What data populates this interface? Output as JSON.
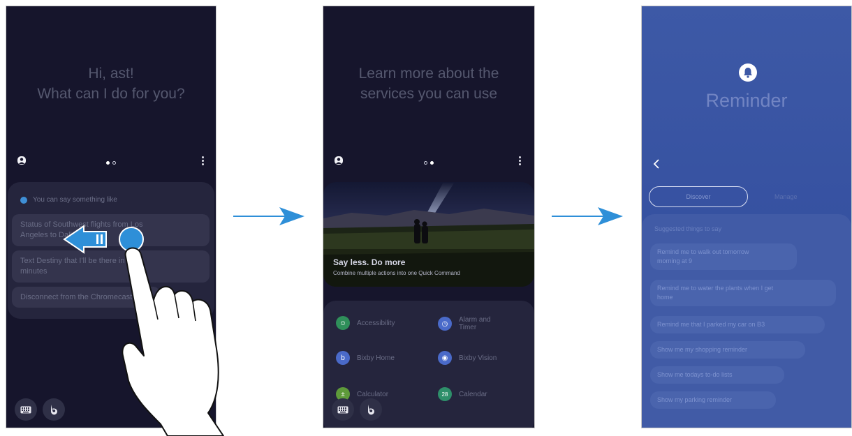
{
  "screen1": {
    "greeting_line1": "Hi, ast!",
    "greeting_line2": "What can I do for you?",
    "hint_label": "You can say something like",
    "suggestions": [
      {
        "line1": "Status of Southwest flights from Los",
        "line2": "Angeles to Dallas"
      },
      {
        "line1": "Text Destiny that I'll be there in five",
        "line2": "minutes"
      },
      {
        "line1": "Disconnect from the Chromecast",
        "line2": ""
      }
    ],
    "icons": {
      "profile": "profile-icon",
      "more": "more-options-icon",
      "keyboard": "keyboard-icon",
      "bixby": "bixby-icon"
    }
  },
  "screen2": {
    "heading_line1": "Learn more about the",
    "heading_line2": "services you can use",
    "hero_title": "Say less. Do more",
    "hero_subtitle": "Combine multiple actions into one Quick Command",
    "services": [
      {
        "label": "Accessibility",
        "icon": "accessibility-icon",
        "color": "#2f8f5a"
      },
      {
        "label": "Alarm and Timer",
        "icon": "clock-icon",
        "color": "#4a6ac9"
      },
      {
        "label": "Bixby Home",
        "icon": "bixby-home-icon",
        "color": "#4a6ac9"
      },
      {
        "label": "Bixby Vision",
        "icon": "eye-icon",
        "color": "#4a6ac9"
      },
      {
        "label": "Calculator",
        "icon": "calculator-icon",
        "color": "#5e9a3a"
      },
      {
        "label": "Calendar",
        "icon": "calendar-icon",
        "color": "#2e8f6a",
        "badge": "28"
      }
    ]
  },
  "screen3": {
    "title": "Reminder",
    "tabs": [
      "Discover",
      "Manage"
    ],
    "suggested_header": "Suggested things to say",
    "suggestions": [
      {
        "line1": "Remind me to walk out tomorrow",
        "line2": "morning at 9"
      },
      {
        "line1": "Remind me to water the plants when I get",
        "line2": "home"
      },
      {
        "line1": "Remind me that I parked my car on B3",
        "line2": ""
      },
      {
        "line1": "Show me my shopping reminder",
        "line2": ""
      },
      {
        "line1": "Show me todays to-do lists",
        "line2": ""
      },
      {
        "line1": "Show my parking reminder",
        "line2": ""
      }
    ],
    "icons": {
      "bell": "bell-icon",
      "back": "back-icon"
    }
  },
  "colors": {
    "accent_arrow": "#2e8fd8",
    "dark_bg": "#16152c",
    "blue_bg": "#3d59a6"
  }
}
